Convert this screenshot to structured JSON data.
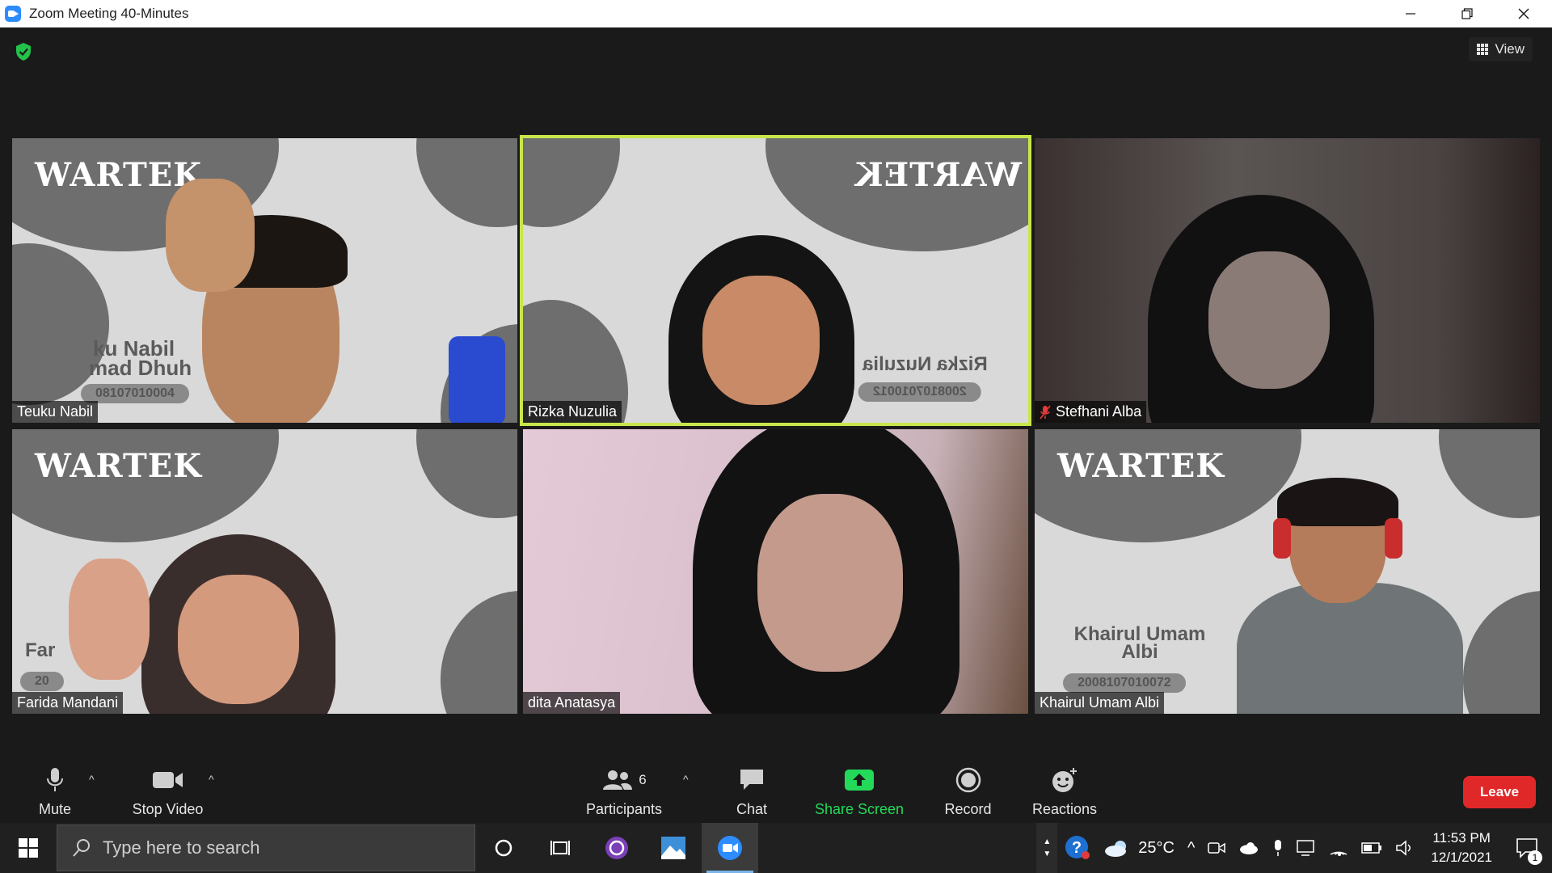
{
  "window": {
    "title": "Zoom Meeting 40-Minutes",
    "controls": [
      "minimize",
      "restore",
      "close"
    ]
  },
  "meeting": {
    "view_label": "View",
    "security_icon": "shield-check-icon",
    "tiles": [
      {
        "name": "Teuku Nabil",
        "badge_name_line1": "ku Nabil",
        "badge_name_line2": "mad Dhuh",
        "badge_id": "08107010004",
        "muted": false,
        "active": false
      },
      {
        "name": "Rizka Nuzulia",
        "badge_name_line1": "Rizka Nuzulia",
        "badge_id": "2008107010012",
        "muted": false,
        "active": true
      },
      {
        "name": "Stefhani Alba",
        "muted": true,
        "active": false
      },
      {
        "name": "Farida Mandani",
        "badge_name_line1": "Far",
        "badge_id": "20",
        "muted": false,
        "active": false
      },
      {
        "name": "dita Anatasya",
        "muted": false,
        "active": false
      },
      {
        "name": "Khairul Umam Albi",
        "badge_name_line1": "Khairul Umam",
        "badge_name_line2": "Albi",
        "badge_id": "2008107010072",
        "muted": false,
        "active": false
      }
    ],
    "logo_text": "WARTEK",
    "active_border_color": "#c8e64b"
  },
  "toolbar": {
    "mute_label": "Mute",
    "stop_video_label": "Stop Video",
    "participants_label": "Participants",
    "participants_count": "6",
    "chat_label": "Chat",
    "share_screen_label": "Share Screen",
    "record_label": "Record",
    "reactions_label": "Reactions",
    "leave_label": "Leave",
    "share_color": "#23d959",
    "leave_color": "#e02828"
  },
  "taskbar": {
    "search_placeholder": "Type here to search",
    "weather_temp": "25°C",
    "time": "11:53 PM",
    "date": "12/1/2021",
    "notification_count": "1"
  }
}
